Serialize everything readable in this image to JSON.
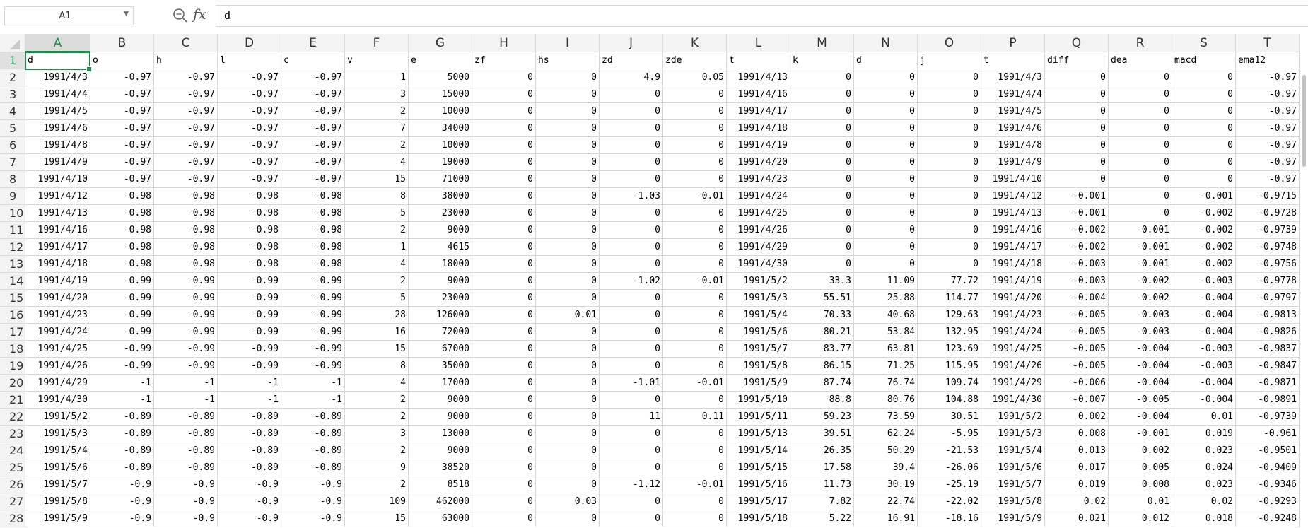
{
  "formula_bar": {
    "name_box": "A1",
    "formula": "d"
  },
  "columns": [
    "A",
    "B",
    "C",
    "D",
    "E",
    "F",
    "G",
    "H",
    "I",
    "J",
    "K",
    "L",
    "M",
    "N",
    "O",
    "P",
    "Q",
    "R",
    "S",
    "T"
  ],
  "active_cell": "A1",
  "headers": [
    "d",
    "o",
    "h",
    "l",
    "c",
    "v",
    "e",
    "zf",
    "hs",
    "zd",
    "zde",
    "t",
    "k",
    "d",
    "j",
    "t",
    "diff",
    "dea",
    "macd",
    "ema12"
  ],
  "rows": [
    [
      "1991/4/3",
      "-0.97",
      "-0.97",
      "-0.97",
      "-0.97",
      "1",
      "5000",
      "0",
      "0",
      "4.9",
      "0.05",
      "1991/4/13",
      "0",
      "0",
      "0",
      "1991/4/3",
      "0",
      "0",
      "0",
      "-0.97"
    ],
    [
      "1991/4/4",
      "-0.97",
      "-0.97",
      "-0.97",
      "-0.97",
      "3",
      "15000",
      "0",
      "0",
      "0",
      "0",
      "1991/4/16",
      "0",
      "0",
      "0",
      "1991/4/4",
      "0",
      "0",
      "0",
      "-0.97"
    ],
    [
      "1991/4/5",
      "-0.97",
      "-0.97",
      "-0.97",
      "-0.97",
      "2",
      "10000",
      "0",
      "0",
      "0",
      "0",
      "1991/4/17",
      "0",
      "0",
      "0",
      "1991/4/5",
      "0",
      "0",
      "0",
      "-0.97"
    ],
    [
      "1991/4/6",
      "-0.97",
      "-0.97",
      "-0.97",
      "-0.97",
      "7",
      "34000",
      "0",
      "0",
      "0",
      "0",
      "1991/4/18",
      "0",
      "0",
      "0",
      "1991/4/6",
      "0",
      "0",
      "0",
      "-0.97"
    ],
    [
      "1991/4/8",
      "-0.97",
      "-0.97",
      "-0.97",
      "-0.97",
      "2",
      "10000",
      "0",
      "0",
      "0",
      "0",
      "1991/4/19",
      "0",
      "0",
      "0",
      "1991/4/8",
      "0",
      "0",
      "0",
      "-0.97"
    ],
    [
      "1991/4/9",
      "-0.97",
      "-0.97",
      "-0.97",
      "-0.97",
      "4",
      "19000",
      "0",
      "0",
      "0",
      "0",
      "1991/4/20",
      "0",
      "0",
      "0",
      "1991/4/9",
      "0",
      "0",
      "0",
      "-0.97"
    ],
    [
      "1991/4/10",
      "-0.97",
      "-0.97",
      "-0.97",
      "-0.97",
      "15",
      "71000",
      "0",
      "0",
      "0",
      "0",
      "1991/4/23",
      "0",
      "0",
      "0",
      "1991/4/10",
      "0",
      "0",
      "0",
      "-0.97"
    ],
    [
      "1991/4/12",
      "-0.98",
      "-0.98",
      "-0.98",
      "-0.98",
      "8",
      "38000",
      "0",
      "0",
      "-1.03",
      "-0.01",
      "1991/4/24",
      "0",
      "0",
      "0",
      "1991/4/12",
      "-0.001",
      "0",
      "-0.001",
      "-0.9715"
    ],
    [
      "1991/4/13",
      "-0.98",
      "-0.98",
      "-0.98",
      "-0.98",
      "5",
      "23000",
      "0",
      "0",
      "0",
      "0",
      "1991/4/25",
      "0",
      "0",
      "0",
      "1991/4/13",
      "-0.001",
      "0",
      "-0.002",
      "-0.9728"
    ],
    [
      "1991/4/16",
      "-0.98",
      "-0.98",
      "-0.98",
      "-0.98",
      "2",
      "9000",
      "0",
      "0",
      "0",
      "0",
      "1991/4/26",
      "0",
      "0",
      "0",
      "1991/4/16",
      "-0.002",
      "-0.001",
      "-0.002",
      "-0.9739"
    ],
    [
      "1991/4/17",
      "-0.98",
      "-0.98",
      "-0.98",
      "-0.98",
      "1",
      "4615",
      "0",
      "0",
      "0",
      "0",
      "1991/4/29",
      "0",
      "0",
      "0",
      "1991/4/17",
      "-0.002",
      "-0.001",
      "-0.002",
      "-0.9748"
    ],
    [
      "1991/4/18",
      "-0.98",
      "-0.98",
      "-0.98",
      "-0.98",
      "4",
      "18000",
      "0",
      "0",
      "0",
      "0",
      "1991/4/30",
      "0",
      "0",
      "0",
      "1991/4/18",
      "-0.003",
      "-0.001",
      "-0.002",
      "-0.9756"
    ],
    [
      "1991/4/19",
      "-0.99",
      "-0.99",
      "-0.99",
      "-0.99",
      "2",
      "9000",
      "0",
      "0",
      "-1.02",
      "-0.01",
      "1991/5/2",
      "33.3",
      "11.09",
      "77.72",
      "1991/4/19",
      "-0.003",
      "-0.002",
      "-0.003",
      "-0.9778"
    ],
    [
      "1991/4/20",
      "-0.99",
      "-0.99",
      "-0.99",
      "-0.99",
      "5",
      "23000",
      "0",
      "0",
      "0",
      "0",
      "1991/5/3",
      "55.51",
      "25.88",
      "114.77",
      "1991/4/20",
      "-0.004",
      "-0.002",
      "-0.004",
      "-0.9797"
    ],
    [
      "1991/4/23",
      "-0.99",
      "-0.99",
      "-0.99",
      "-0.99",
      "28",
      "126000",
      "0",
      "0.01",
      "0",
      "0",
      "1991/5/4",
      "70.33",
      "40.68",
      "129.63",
      "1991/4/23",
      "-0.005",
      "-0.003",
      "-0.004",
      "-0.9813"
    ],
    [
      "1991/4/24",
      "-0.99",
      "-0.99",
      "-0.99",
      "-0.99",
      "16",
      "72000",
      "0",
      "0",
      "0",
      "0",
      "1991/5/6",
      "80.21",
      "53.84",
      "132.95",
      "1991/4/24",
      "-0.005",
      "-0.003",
      "-0.004",
      "-0.9826"
    ],
    [
      "1991/4/25",
      "-0.99",
      "-0.99",
      "-0.99",
      "-0.99",
      "15",
      "67000",
      "0",
      "0",
      "0",
      "0",
      "1991/5/7",
      "83.77",
      "63.81",
      "123.69",
      "1991/4/25",
      "-0.005",
      "-0.004",
      "-0.003",
      "-0.9837"
    ],
    [
      "1991/4/26",
      "-0.99",
      "-0.99",
      "-0.99",
      "-0.99",
      "8",
      "35000",
      "0",
      "0",
      "0",
      "0",
      "1991/5/8",
      "86.15",
      "71.25",
      "115.95",
      "1991/4/26",
      "-0.005",
      "-0.004",
      "-0.003",
      "-0.9847"
    ],
    [
      "1991/4/29",
      "-1",
      "-1",
      "-1",
      "-1",
      "4",
      "17000",
      "0",
      "0",
      "-1.01",
      "-0.01",
      "1991/5/9",
      "87.74",
      "76.74",
      "109.74",
      "1991/4/29",
      "-0.006",
      "-0.004",
      "-0.004",
      "-0.9871"
    ],
    [
      "1991/4/30",
      "-1",
      "-1",
      "-1",
      "-1",
      "2",
      "9000",
      "0",
      "0",
      "0",
      "0",
      "1991/5/10",
      "88.8",
      "80.76",
      "104.88",
      "1991/4/30",
      "-0.007",
      "-0.005",
      "-0.004",
      "-0.9891"
    ],
    [
      "1991/5/2",
      "-0.89",
      "-0.89",
      "-0.89",
      "-0.89",
      "2",
      "9000",
      "0",
      "0",
      "11",
      "0.11",
      "1991/5/11",
      "59.23",
      "73.59",
      "30.51",
      "1991/5/2",
      "0.002",
      "-0.004",
      "0.01",
      "-0.9739"
    ],
    [
      "1991/5/3",
      "-0.89",
      "-0.89",
      "-0.89",
      "-0.89",
      "3",
      "13000",
      "0",
      "0",
      "0",
      "0",
      "1991/5/13",
      "39.51",
      "62.24",
      "-5.95",
      "1991/5/3",
      "0.008",
      "-0.001",
      "0.019",
      "-0.961"
    ],
    [
      "1991/5/4",
      "-0.89",
      "-0.89",
      "-0.89",
      "-0.89",
      "2",
      "9000",
      "0",
      "0",
      "0",
      "0",
      "1991/5/14",
      "26.35",
      "50.29",
      "-21.53",
      "1991/5/4",
      "0.013",
      "0.002",
      "0.023",
      "-0.9501"
    ],
    [
      "1991/5/6",
      "-0.89",
      "-0.89",
      "-0.89",
      "-0.89",
      "9",
      "38520",
      "0",
      "0",
      "0",
      "0",
      "1991/5/15",
      "17.58",
      "39.4",
      "-26.06",
      "1991/5/6",
      "0.017",
      "0.005",
      "0.024",
      "-0.9409"
    ],
    [
      "1991/5/7",
      "-0.9",
      "-0.9",
      "-0.9",
      "-0.9",
      "2",
      "8518",
      "0",
      "0",
      "-1.12",
      "-0.01",
      "1991/5/16",
      "11.73",
      "30.19",
      "-25.19",
      "1991/5/7",
      "0.019",
      "0.008",
      "0.023",
      "-0.9346"
    ],
    [
      "1991/5/8",
      "-0.9",
      "-0.9",
      "-0.9",
      "-0.9",
      "109",
      "462000",
      "0",
      "0.03",
      "0",
      "0",
      "1991/5/17",
      "7.82",
      "22.74",
      "-22.02",
      "1991/5/8",
      "0.02",
      "0.01",
      "0.02",
      "-0.9293"
    ],
    [
      "1991/5/9",
      "-0.9",
      "-0.9",
      "-0.9",
      "-0.9",
      "15",
      "63000",
      "0",
      "0",
      "0",
      "0",
      "1991/5/18",
      "5.22",
      "16.91",
      "-18.16",
      "1991/5/9",
      "0.021",
      "0.012",
      "0.018",
      "-0.9248"
    ]
  ]
}
